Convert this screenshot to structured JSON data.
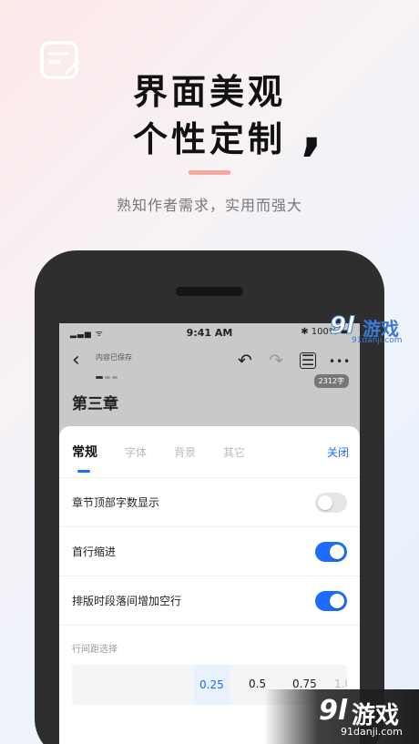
{
  "hero": {
    "line1": "界面美观",
    "line2": "个性定制",
    "subtitle": "熟知作者需求，实用而强大",
    "accent_color": "#f6a99d"
  },
  "status_bar": {
    "signal": "▂▃▅ ᯤ",
    "time": "9:41 AM",
    "battery": "✱ 100% ▬"
  },
  "editor": {
    "saved_text": "内容已保存",
    "back_icon": "‹",
    "undo_icon": "↶",
    "redo_icon": "↷",
    "format_icon": "☰",
    "more_icon": "•••",
    "word_count": "2312字",
    "chapter_title": "第三章"
  },
  "settings": {
    "tabs": [
      {
        "label": "常规"
      },
      {
        "label": "字体"
      },
      {
        "label": "背景"
      },
      {
        "label": "其它"
      }
    ],
    "close_label": "关闭",
    "rows": [
      {
        "label": "章节顶部字数显示",
        "enabled": false
      },
      {
        "label": "首行缩进",
        "enabled": true
      },
      {
        "label": "排版时段落间增加空行",
        "enabled": true
      }
    ],
    "spacing_label": "行间距选择",
    "spacing_options": [
      "0.25",
      "0.5",
      "0.75",
      "1.0"
    ],
    "spacing_selected": "0.25",
    "accent_color": "#1e6bff"
  },
  "watermark": {
    "logo": "9l",
    "brand": "游戏",
    "url": "91danji.com"
  }
}
